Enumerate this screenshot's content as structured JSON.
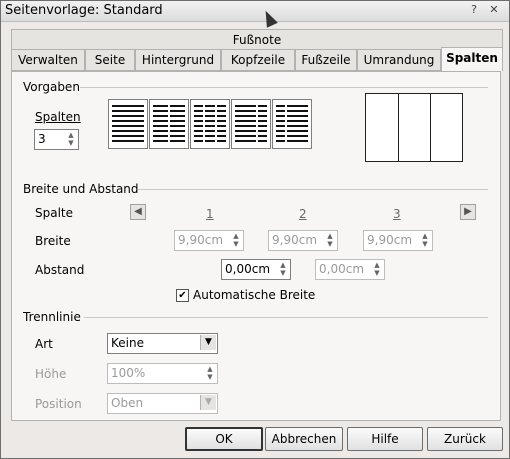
{
  "window": {
    "title": "Seitenvorlage: Standard"
  },
  "tabs_top": {
    "label": "Fußnote"
  },
  "tabs": [
    {
      "label": "Verwalten"
    },
    {
      "label": "Seite"
    },
    {
      "label": "Hintergrund"
    },
    {
      "label": "Kopfzeile"
    },
    {
      "label": "Fußzeile"
    },
    {
      "label": "Umrandung"
    },
    {
      "label": "Spalten"
    }
  ],
  "vorgaben": {
    "title": "Vorgaben",
    "spalten_label": "Spalten",
    "spalten_value": "3"
  },
  "breite_abstand": {
    "title": "Breite und Abstand",
    "spalte_label": "Spalte",
    "breite_label": "Breite",
    "abstand_label": "Abstand",
    "col_numbers": [
      "1",
      "2",
      "3"
    ],
    "breite_values": [
      "9,90cm",
      "9,90cm",
      "9,90cm"
    ],
    "abstand_values": [
      "0,00cm",
      "0,00cm"
    ],
    "auto_width_label": "Automatische Breite",
    "auto_width_checked": true
  },
  "trennlinie": {
    "title": "Trennlinie",
    "art_label": "Art",
    "art_value": "Keine",
    "hoehe_label": "Höhe",
    "hoehe_value": "100%",
    "position_label": "Position",
    "position_value": "Oben"
  },
  "buttons": {
    "ok": "OK",
    "cancel": "Abbrechen",
    "help": "Hilfe",
    "back": "Zurück"
  }
}
